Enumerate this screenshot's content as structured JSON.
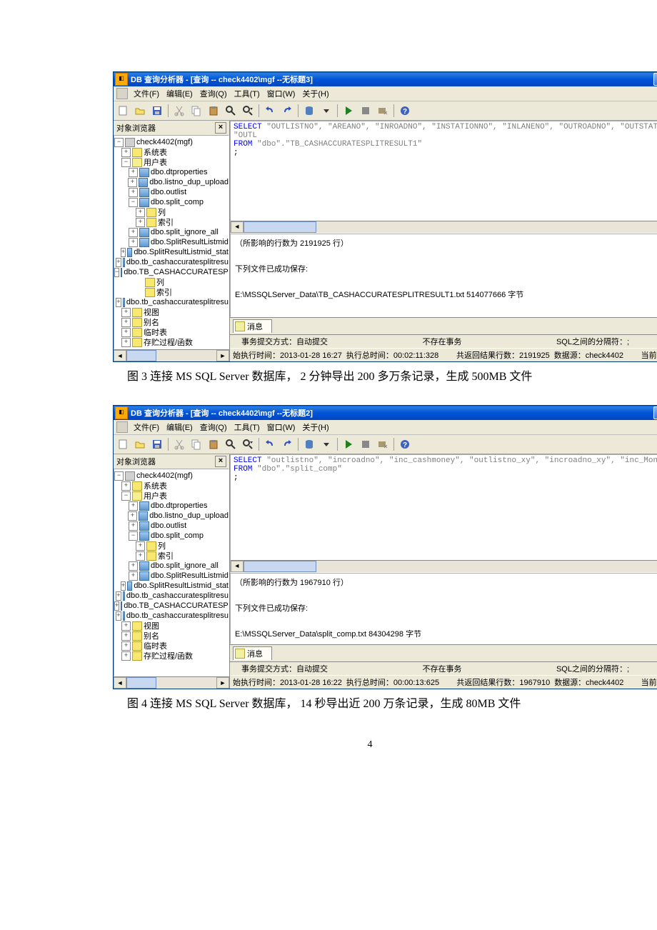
{
  "figures": [
    {
      "title": "DB 查询分析器 - [查询 -- check4402\\mgf  --无标题3]",
      "menus": [
        "文件(F)",
        "编辑(E)",
        "查询(Q)",
        "工具(T)",
        "窗口(W)",
        "关于(H)"
      ],
      "objBrowserTitle": "对象浏览器",
      "tree": {
        "root": "check4402(mgf)",
        "l1": [
          "系统表",
          "用户表"
        ],
        "tables": [
          "dbo.dtproperties",
          "dbo.listno_dup_upload",
          "dbo.outlist",
          "dbo.split_comp"
        ],
        "cols": [
          "列",
          "索引"
        ],
        "tables2": [
          "dbo.split_ignore_all",
          "dbo.SplitResultListmid",
          "dbo.SplitResultListmid_stat",
          "dbo.tb_cashaccuratesplitresu"
        ],
        "tables3": "dbo.TB_CASHACCURATESPLITRESU",
        "cols2": [
          "列",
          "索引"
        ],
        "tables4": "dbo.tb_cashaccuratesplitresu",
        "l2": [
          "视图",
          "别名",
          "临时表",
          "存贮过程/函数"
        ]
      },
      "sql": {
        "line1a": "SELECT",
        "line1b": "   \"OUTLISTNO\", \"AREANO\", \"INROADNO\", \"INSTATIONNO\", \"INLANENO\", \"OUTROADNO\", \"OUTSTATIONNO\", \"OUTL",
        "line2a": "FROM",
        "line2b": "   \"dbo\".\"TB_CASHACCURATESPLITRESULT1\"",
        "line3": ";"
      },
      "sqlHeight": 152,
      "msg": {
        "l1": "（所影响的行数为 2191925 行）",
        "l2": "下列文件已成功保存:",
        "l3": "E:\\MSSQLServer_Data\\TB_CASHACCURATESPLITRESULT1.txt  514077666  字节"
      },
      "msgTabLabel": "消息",
      "status1": {
        "a": "事务提交方式：自动提交",
        "b": "不存在事务",
        "c": "SQL之间的分隔符：;"
      },
      "status2": {
        "a": "始执行时间：2013-01-28 16:27",
        "b": "执行总时间：00:02:11:328",
        "c": "共返回结果行数：2191925",
        "d": "数据源：check4402",
        "e": "当前用户：mgf"
      },
      "caption": "图 3     连接 MS SQL Server 数据库， 2 分钟导出 200 多万条记录，生成 500MB 文件"
    },
    {
      "title": "DB 查询分析器 - [查询 -- check4402\\mgf  --无标题2]",
      "menus": [
        "文件(F)",
        "编辑(E)",
        "查询(Q)",
        "工具(T)",
        "窗口(W)",
        "关于(H)"
      ],
      "objBrowserTitle": "对象浏览器",
      "tree": {
        "root": "check4402(mgf)",
        "l1": [
          "系统表",
          "用户表"
        ],
        "tables": [
          "dbo.dtproperties",
          "dbo.listno_dup_upload",
          "dbo.outlist",
          "dbo.split_comp"
        ],
        "cols": [
          "列",
          "索引"
        ],
        "tables2": [
          "dbo.split_ignore_all",
          "dbo.SplitResultListmid",
          "dbo.SplitResultListmid_stat",
          "dbo.tb_cashaccuratesplitresu",
          "dbo.TB_CASHACCURATESPLITRESU",
          "dbo.tb_cashaccuratesplitresu"
        ],
        "l2": [
          "视图",
          "别名",
          "临时表",
          "存贮过程/函数"
        ]
      },
      "sql": {
        "line1a": "SELECT",
        "line1b": "   \"outlistno\", \"incroadno\", \"inc_cashmoney\", \"outlistno_xy\", \"incroadno_xy\", \"inc_Money_xy\"",
        "line2a": "FROM",
        "line2b": "   \"dbo\".\"split_comp\"",
        "line3": ";"
      },
      "sqlHeight": 160,
      "msg": {
        "l1": "（所影响的行数为 1967910 行）",
        "l2": "下列文件已成功保存:",
        "l3": "E:\\MSSQLServer_Data\\split_comp.txt  84304298  字节"
      },
      "msgTabLabel": "消息",
      "status1": {
        "a": "事务提交方式：自动提交",
        "b": "不存在事务",
        "c": "SQL之间的分隔符：;"
      },
      "status2": {
        "a": "始执行时间：2013-01-28 16:22",
        "b": "执行总时间：00:00:13:625",
        "c": "共返回结果行数：1967910",
        "d": "数据源：check4402",
        "e": "当前用户：mgf"
      },
      "caption": "图 4     连接 MS SQL Server 数据库， 14 秒导出近 200 万条记录，生成 80MB 文件"
    }
  ],
  "pageNumber": "4"
}
